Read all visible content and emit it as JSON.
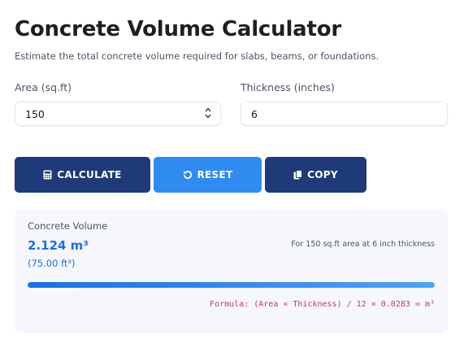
{
  "header": {
    "title": "Concrete Volume Calculator",
    "subtitle": "Estimate the total concrete volume required for slabs, beams, or foundations."
  },
  "inputs": {
    "area": {
      "label": "Area (sq.ft)",
      "value": "150"
    },
    "thickness": {
      "label": "Thickness (inches)",
      "value": "6"
    }
  },
  "buttons": {
    "calculate": {
      "label": "CALCULATE",
      "icon": "calculator-icon",
      "color": "#1e3a78"
    },
    "reset": {
      "label": "RESET",
      "icon": "reset-icon",
      "color": "#2f8bf0"
    },
    "copy": {
      "label": "COPY",
      "icon": "copy-icon",
      "color": "#1e3a78"
    }
  },
  "result": {
    "label": "Concrete Volume",
    "value": "2.124 m³",
    "alt_value": "(75.00 ft³)",
    "note": "For 150 sq.ft area at 6 inch thickness",
    "progress": 1.0,
    "formula": "Formula: (Area × Thickness) / 12 × 0.0283 = m³"
  },
  "colors": {
    "accent": "#1f6fe0",
    "formula": "#c2366e",
    "panel": "#f5f7fc"
  }
}
